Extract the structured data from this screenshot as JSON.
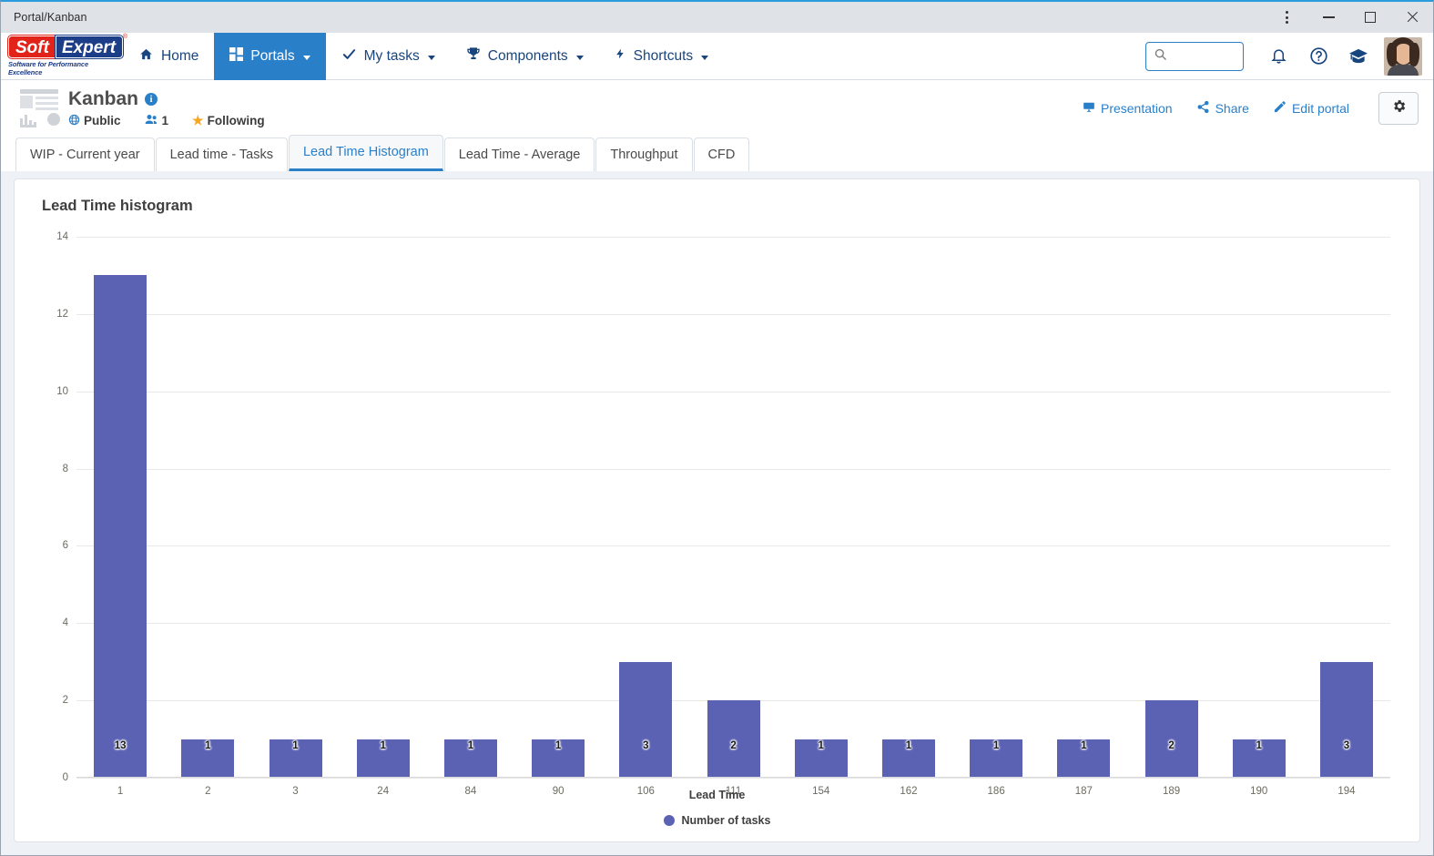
{
  "window": {
    "title": "Portal/Kanban",
    "controls": {
      "menu": "more-options",
      "minimize": "minimize",
      "maximize": "maximize",
      "close": "close"
    }
  },
  "brand": {
    "name_part1": "Soft",
    "name_part2": "Expert",
    "registered": "®",
    "tagline": "Software for Performance Excellence"
  },
  "topnav": {
    "items": [
      {
        "label": "Home",
        "icon": "home-icon",
        "caret": false,
        "active": false
      },
      {
        "label": "Portals",
        "icon": "grid-icon",
        "caret": true,
        "active": true
      },
      {
        "label": "My tasks",
        "icon": "check-icon",
        "caret": true,
        "active": false
      },
      {
        "label": "Components",
        "icon": "trophy-icon",
        "caret": true,
        "active": false
      },
      {
        "label": "Shortcuts",
        "icon": "bolt-icon",
        "caret": true,
        "active": false
      }
    ],
    "search": {
      "value": "",
      "placeholder": ""
    },
    "right_icons": [
      "bell-icon",
      "help-icon",
      "graduation-cap-icon",
      "avatar"
    ]
  },
  "portal": {
    "title": "Kanban",
    "info_badge": "i",
    "visibility": "Public",
    "members_count": "1",
    "following": "Following",
    "actions": [
      {
        "label": "Presentation",
        "icon": "presentation-icon"
      },
      {
        "label": "Share",
        "icon": "share-icon"
      },
      {
        "label": "Edit portal",
        "icon": "pencil-icon"
      }
    ],
    "settings_icon": "gear-icon"
  },
  "tabs": [
    {
      "label": "WIP - Current year",
      "active": false
    },
    {
      "label": "Lead time - Tasks",
      "active": false
    },
    {
      "label": "Lead Time Histogram",
      "active": true
    },
    {
      "label": "Lead Time - Average",
      "active": false
    },
    {
      "label": "Throughput",
      "active": false
    },
    {
      "label": "CFD",
      "active": false
    }
  ],
  "card": {
    "title": "Lead Time histogram"
  },
  "colors": {
    "bar": "#5b62b3",
    "accent": "#2a7fc9",
    "brand_red": "#e2231a",
    "brand_blue": "#1c3d87",
    "star": "#f5a623"
  },
  "chart_data": {
    "type": "bar",
    "title": "Lead Time histogram",
    "xlabel": "Lead Time",
    "ylabel": "",
    "categories": [
      "1",
      "2",
      "3",
      "24",
      "84",
      "90",
      "106",
      "111",
      "154",
      "162",
      "186",
      "187",
      "189",
      "190",
      "194"
    ],
    "values": [
      13,
      1,
      1,
      1,
      1,
      1,
      3,
      2,
      1,
      1,
      1,
      1,
      2,
      1,
      3
    ],
    "series": [
      {
        "name": "Number of tasks",
        "color": "#5b62b3",
        "values": [
          13,
          1,
          1,
          1,
          1,
          1,
          3,
          2,
          1,
          1,
          1,
          1,
          2,
          1,
          3
        ]
      }
    ],
    "yticks": [
      0,
      2,
      4,
      6,
      8,
      10,
      12,
      14
    ],
    "ylim": [
      0,
      14
    ],
    "grid": true,
    "legend": {
      "position": "bottom",
      "entries": [
        "Number of tasks"
      ]
    },
    "data_labels": true
  }
}
